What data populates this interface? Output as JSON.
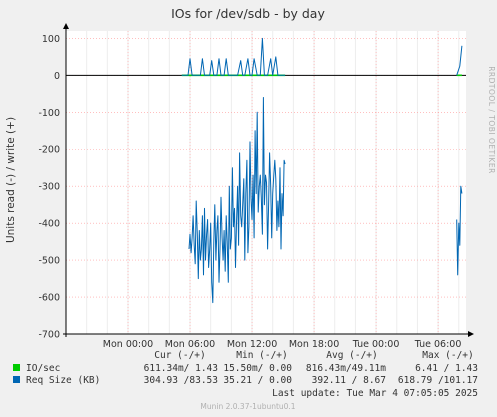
{
  "colors": {
    "background": "#f0f0f0",
    "plot_background": "#ffffff",
    "grid": "#ff9999",
    "io_series": "#00cc00",
    "req_size_series": "#0066b3",
    "zero_line": "#000000"
  },
  "chart_data": {
    "type": "line",
    "title": "IOs for /dev/sdb - by day",
    "ylabel": "Units read (-) / write (+)",
    "ylim": [
      -700,
      120
    ],
    "yticks": [
      100,
      0,
      -100,
      -200,
      -300,
      -400,
      -500,
      -600,
      -700
    ],
    "xlim_hours": [
      -6,
      32.7
    ],
    "xticks": [
      {
        "label": "Mon 00:00",
        "hour": 0
      },
      {
        "label": "Mon 06:00",
        "hour": 6
      },
      {
        "label": "Mon 12:00",
        "hour": 12
      },
      {
        "label": "Mon 18:00",
        "hour": 18
      },
      {
        "label": "Tue 00:00",
        "hour": 24
      },
      {
        "label": "Tue 06:00",
        "hour": 30
      }
    ],
    "grid": true,
    "series": [
      {
        "name": "IO/sec",
        "color": "#00cc00",
        "segments": [
          {
            "x": [
              5.2,
              7.8,
              10.5,
              13.2,
              15.2
            ],
            "y": [
              0,
              0,
              0,
              0,
              0
            ]
          },
          {
            "x": [
              31.8,
              32.3
            ],
            "y": [
              0,
              0
            ]
          }
        ]
      },
      {
        "name": "Req Size (KB) write",
        "color": "#0066b3",
        "segments": [
          {
            "x": [
              5.2,
              5.6,
              5.8,
              6.0,
              6.2,
              6.5,
              6.8,
              7.0,
              7.2,
              7.4,
              7.7,
              7.9,
              8.1,
              8.3,
              8.6,
              8.8,
              9.0,
              9.3,
              9.5,
              9.7,
              10.0,
              10.3,
              10.6,
              10.9,
              11.1,
              11.3,
              11.6,
              11.8,
              12.0,
              12.2,
              12.5,
              12.8,
              13.0,
              13.2,
              13.5,
              13.8,
              14.0,
              14.3,
              14.5,
              14.7,
              15.0,
              15.2
            ],
            "y": [
              0,
              0,
              0,
              45,
              0,
              0,
              0,
              0,
              45,
              0,
              0,
              0,
              40,
              0,
              0,
              45,
              0,
              0,
              45,
              0,
              0,
              0,
              0,
              40,
              0,
              0,
              45,
              0,
              0,
              45,
              0,
              0,
              100,
              0,
              0,
              45,
              0,
              50,
              0,
              0,
              0,
              0
            ]
          },
          {
            "x": [
              31.8,
              32.1,
              32.3
            ],
            "y": [
              0,
              25,
              80
            ]
          }
        ]
      },
      {
        "name": "Req Size (KB) read",
        "color": "#0066b3",
        "segments": [
          {
            "x": [
              5.9,
              6.0,
              6.1,
              6.2,
              6.3,
              6.4,
              6.5,
              6.6,
              6.7,
              6.8,
              6.9,
              7.0,
              7.1,
              7.2,
              7.3,
              7.4,
              7.5,
              7.6,
              7.7,
              7.8,
              7.9,
              8.0,
              8.1,
              8.2,
              8.3,
              8.4,
              8.5,
              8.6,
              8.7,
              8.8,
              8.9,
              9.0,
              9.1,
              9.2,
              9.3,
              9.4,
              9.5,
              9.6,
              9.7,
              9.8,
              9.9,
              10.0,
              10.1,
              10.2,
              10.3,
              10.4,
              10.5,
              10.6,
              10.7,
              10.8,
              10.9,
              11.0,
              11.1,
              11.2,
              11.3,
              11.4,
              11.5,
              11.6,
              11.7,
              11.8,
              11.9,
              12.0,
              12.1,
              12.2,
              12.3,
              12.4,
              12.5,
              12.6,
              12.7,
              12.8,
              12.9,
              13.0,
              13.1,
              13.2,
              13.3,
              13.4,
              13.5,
              13.6,
              13.7,
              13.8,
              13.9,
              14.0,
              14.1,
              14.2,
              14.3,
              14.4,
              14.5,
              14.6,
              14.7,
              14.8,
              14.9,
              15.0,
              15.1,
              15.2
            ],
            "y": [
              -470,
              -430,
              -480,
              -440,
              -380,
              -460,
              -510,
              -340,
              -430,
              -550,
              -420,
              -500,
              -470,
              -380,
              -540,
              -360,
              -500,
              -430,
              -390,
              -520,
              -470,
              -400,
              -560,
              -615,
              -450,
              -350,
              -500,
              -420,
              -380,
              -560,
              -470,
              -330,
              -440,
              -500,
              -420,
              -530,
              -380,
              -450,
              -560,
              -300,
              -470,
              -440,
              -250,
              -410,
              -360,
              -520,
              -400,
              -300,
              -460,
              -210,
              -380,
              -410,
              -350,
              -280,
              -500,
              -320,
              -230,
              -480,
              -410,
              -180,
              -330,
              -390,
              -270,
              -440,
              -150,
              -320,
              -100,
              -370,
              -300,
              -270,
              -330,
              -430,
              -60,
              -350,
              -270,
              -290,
              -470,
              -350,
              -210,
              -300,
              -440,
              -320,
              -270,
              -230,
              -280,
              -420,
              -340,
              -410,
              -250,
              -470,
              -320,
              -380,
              -230,
              -240
            ]
          },
          {
            "x": [
              31.8,
              31.9,
              32.0,
              32.1,
              32.2,
              32.3
            ],
            "y": [
              -390,
              -540,
              -400,
              -460,
              -300,
              -320
            ]
          }
        ]
      }
    ],
    "legend": {
      "headers": [
        "Cur (-/+)",
        "Min (-/+)",
        "Avg (-/+)",
        "Max (-/+)"
      ],
      "rows": [
        {
          "name": "IO/sec",
          "color": "#00cc00",
          "cur": "611.34m/ 1.43",
          "min": "15.50m/ 0.00",
          "avg": "816.43m/49.11m",
          "max": "6.41 / 1.43"
        },
        {
          "name": "Req Size (KB)",
          "color": "#0066b3",
          "cur": "304.93 /83.53",
          "min": "35.21 / 0.00",
          "avg": "392.11 / 8.67",
          "max": "618.79 /101.17"
        }
      ]
    }
  },
  "last_update": "Last update: Tue Mar  4 07:05:05 2025",
  "side_label": "RRDTOOL / TOBI OETIKER",
  "footer": "Munin 2.0.37-1ubuntu0.1"
}
